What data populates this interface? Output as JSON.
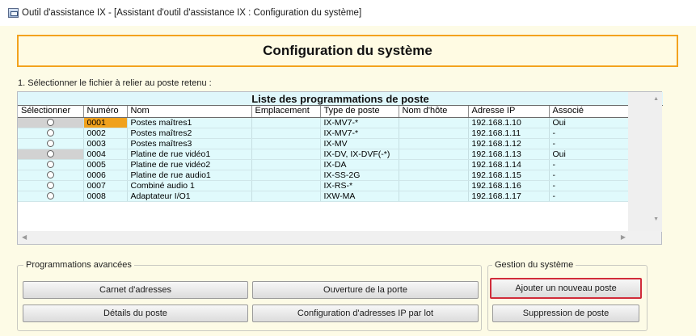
{
  "window": {
    "title": "Outil d'assistance IX - [Assistant d'outil d'assistance IX : Configuration du système]",
    "app_icon": "app-window-icon"
  },
  "header": {
    "title": "Configuration du système"
  },
  "instruction": "1. Sélectionner le fichier à relier au poste retenu :",
  "station_list": {
    "title": "Liste des programmations de poste",
    "columns": [
      "Sélectionner",
      "Numéro",
      "Nom",
      "Emplacement",
      "Type de poste",
      "Nom d'hôte",
      "Adresse IP",
      "Associé"
    ],
    "rows": [
      {
        "numero": "0001",
        "nom": "Postes maîtres1",
        "emplacement": "",
        "type": "IX-MV7-*",
        "hote": "",
        "ip": "192.168.1.10",
        "associe": "Oui"
      },
      {
        "numero": "0002",
        "nom": "Postes maîtres2",
        "emplacement": "",
        "type": "IX-MV7-*",
        "hote": "",
        "ip": "192.168.1.11",
        "associe": "-"
      },
      {
        "numero": "0003",
        "nom": "Postes maîtres3",
        "emplacement": "",
        "type": "IX-MV",
        "hote": "",
        "ip": "192.168.1.12",
        "associe": "-"
      },
      {
        "numero": "0004",
        "nom": "Platine de rue vidéo1",
        "emplacement": "",
        "type": "IX-DV, IX-DVF(-*)",
        "hote": "",
        "ip": "192.168.1.13",
        "associe": "Oui"
      },
      {
        "numero": "0005",
        "nom": "Platine de rue vidéo2",
        "emplacement": "",
        "type": "IX-DA",
        "hote": "",
        "ip": "192.168.1.14",
        "associe": "-"
      },
      {
        "numero": "0006",
        "nom": "Platine de rue audio1",
        "emplacement": "",
        "type": "IX-SS-2G",
        "hote": "",
        "ip": "192.168.1.15",
        "associe": "-"
      },
      {
        "numero": "0007",
        "nom": "Combiné audio 1",
        "emplacement": "",
        "type": "IX-RS-*",
        "hote": "",
        "ip": "192.168.1.16",
        "associe": "-"
      },
      {
        "numero": "0008",
        "nom": "Adaptateur I/O1",
        "emplacement": "",
        "type": "IXW-MA",
        "hote": "",
        "ip": "192.168.1.17",
        "associe": "-"
      }
    ]
  },
  "advanced": {
    "label": "Programmations avancées",
    "buttons": {
      "address_book": "Carnet d'adresses",
      "door_release": "Ouverture de la porte",
      "station_details": "Détails du poste",
      "batch_ip": "Configuration d'adresses IP par lot"
    }
  },
  "system": {
    "label": "Gestion du système",
    "buttons": {
      "add_station": "Ajouter un nouveau poste",
      "delete_station": "Suppression de poste"
    }
  },
  "colors": {
    "accent_orange": "#f3a21e",
    "row_background": "#e0fafc",
    "highlight_red": "#d12c3a",
    "panel_background": "#fdfbe6"
  }
}
